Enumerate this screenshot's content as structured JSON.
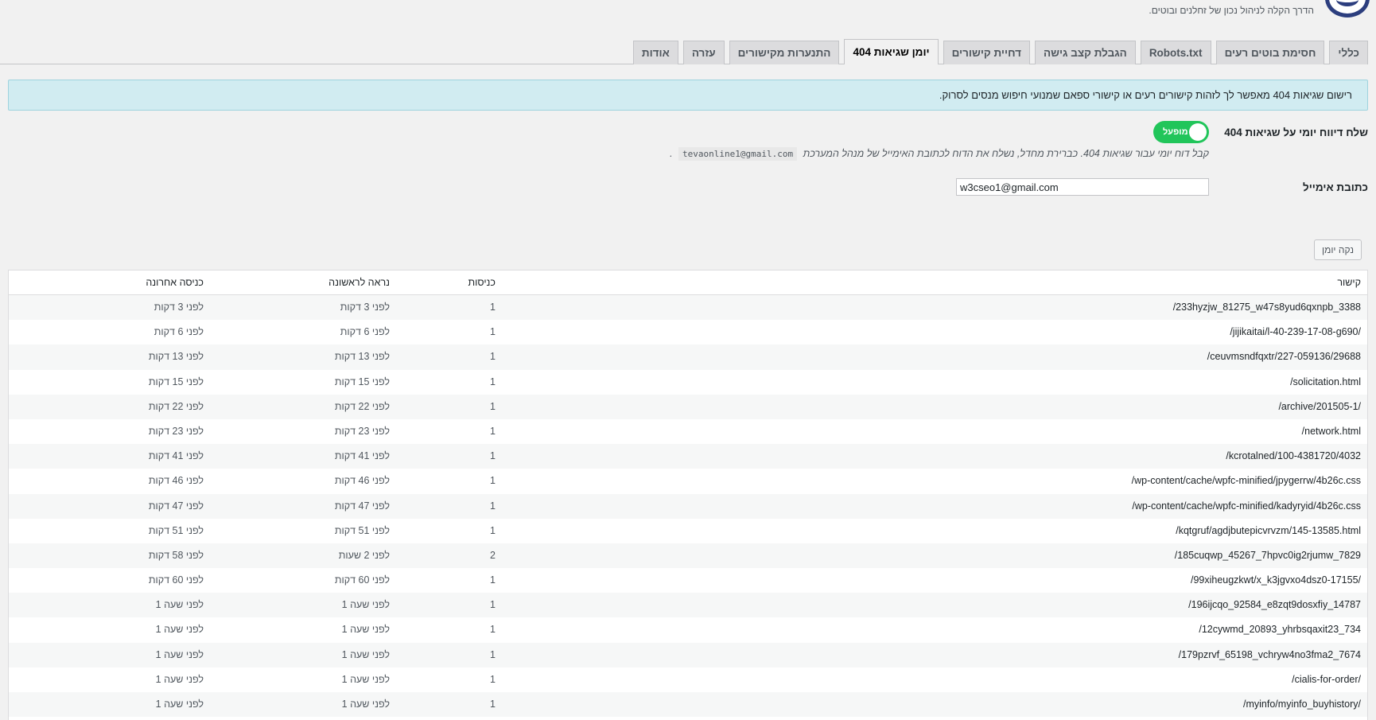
{
  "header": {
    "tagline": "הדרך הקלה לניהול נכון של זחלנים ובוטים."
  },
  "tabs": [
    {
      "label": "כללי",
      "active": false
    },
    {
      "label": "חסימת בוטים רעים",
      "active": false
    },
    {
      "label": "Robots.txt",
      "active": false
    },
    {
      "label": "הגבלת קצב גישה",
      "active": false
    },
    {
      "label": "דחיית קישורים",
      "active": false
    },
    {
      "label": "יומן שגיאות 404",
      "active": true
    },
    {
      "label": "התנערות מקישורים",
      "active": false
    },
    {
      "label": "עזרה",
      "active": false
    },
    {
      "label": "אודות",
      "active": false
    }
  ],
  "notice": {
    "text": "רישום שגיאות 404 מאפשר לך לזהות קישורים רעים או קישורי ספאם שמנועי חיפוש מנסים לסרוק."
  },
  "daily_report": {
    "label": "שלח דיווח יומי על שגיאות 404",
    "toggle_text": "מופעל",
    "toggle_on": true,
    "description": "קבל דוח יומי עבור שגיאות 404. כברירת מחדל, נשלח את הדוח לכתובת האימייל של מנהל המערכת",
    "admin_email": "tevaonline1@gmail.com",
    "description_end": "."
  },
  "email": {
    "label": "כתובת אימייל",
    "value": "w3cseo1@gmail.com"
  },
  "clear_button": "נקה יומן",
  "table": {
    "headers": {
      "link": "קישור",
      "hits": "כניסות",
      "first_seen": "נראה לראשונה",
      "last_hit": "כניסה אחרונה"
    },
    "rows": [
      {
        "link": "/233hyzjw_81275_w47s8yud6qxnpb_3388",
        "hits": "1",
        "first_seen": "לפני 3 דקות",
        "last_hit": "לפני 3 דקות"
      },
      {
        "link": "/jijikaitai/l-40-239-17-08-g690/",
        "hits": "1",
        "first_seen": "לפני 6 דקות",
        "last_hit": "לפני 6 דקות"
      },
      {
        "link": "/ceuvmsndfqxtr/227-059136/29688",
        "hits": "1",
        "first_seen": "לפני 13 דקות",
        "last_hit": "לפני 13 דקות"
      },
      {
        "link": "/solicitation.html",
        "hits": "1",
        "first_seen": "לפני 15 דקות",
        "last_hit": "לפני 15 דקות"
      },
      {
        "link": "/archive/201505-1/",
        "hits": "1",
        "first_seen": "לפני 22 דקות",
        "last_hit": "לפני 22 דקות"
      },
      {
        "link": "/network.html",
        "hits": "1",
        "first_seen": "לפני 23 דקות",
        "last_hit": "לפני 23 דקות"
      },
      {
        "link": "/kcrotalned/100-4381720/4032",
        "hits": "1",
        "first_seen": "לפני 41 דקות",
        "last_hit": "לפני 41 דקות"
      },
      {
        "link": "/wp-content/cache/wpfc-minified/jpygerrw/4b26c.css",
        "hits": "1",
        "first_seen": "לפני 46 דקות",
        "last_hit": "לפני 46 דקות"
      },
      {
        "link": "/wp-content/cache/wpfc-minified/kadyryid/4b26c.css",
        "hits": "1",
        "first_seen": "לפני 47 דקות",
        "last_hit": "לפני 47 דקות"
      },
      {
        "link": "/kqtgruf/agdjbutepicvrvzm/145-13585.html",
        "hits": "1",
        "first_seen": "לפני 51 דקות",
        "last_hit": "לפני 51 דקות"
      },
      {
        "link": "/185cuqwp_45267_7hpvc0ig2rjumw_7829",
        "hits": "2",
        "first_seen": "לפני 2 שעות",
        "last_hit": "לפני 58 דקות"
      },
      {
        "link": "/99xiheugzkwt/x_k3jgvxo4dsz0-17155/",
        "hits": "1",
        "first_seen": "לפני 60 דקות",
        "last_hit": "לפני 60 דקות"
      },
      {
        "link": "/196ijcqo_92584_e8zqt9dosxfiy_14787",
        "hits": "1",
        "first_seen": "לפני שעה 1",
        "last_hit": "לפני שעה 1"
      },
      {
        "link": "/12cywmd_20893_yhrbsqaxit23_734",
        "hits": "1",
        "first_seen": "לפני שעה 1",
        "last_hit": "לפני שעה 1"
      },
      {
        "link": "/179pzrvf_65198_vchryw4no3fma2_7674",
        "hits": "1",
        "first_seen": "לפני שעה 1",
        "last_hit": "לפני שעה 1"
      },
      {
        "link": "/cialis-for-order/",
        "hits": "1",
        "first_seen": "לפני שעה 1",
        "last_hit": "לפני שעה 1"
      },
      {
        "link": "/myinfo/myinfo_buyhistory/",
        "hits": "1",
        "first_seen": "לפני שעה 1",
        "last_hit": "לפני שעה 1"
      }
    ]
  },
  "colors": {
    "toggle_on": "#21c55a",
    "notice_bg": "#d1ecf1",
    "logo": "#2c3e7e"
  }
}
